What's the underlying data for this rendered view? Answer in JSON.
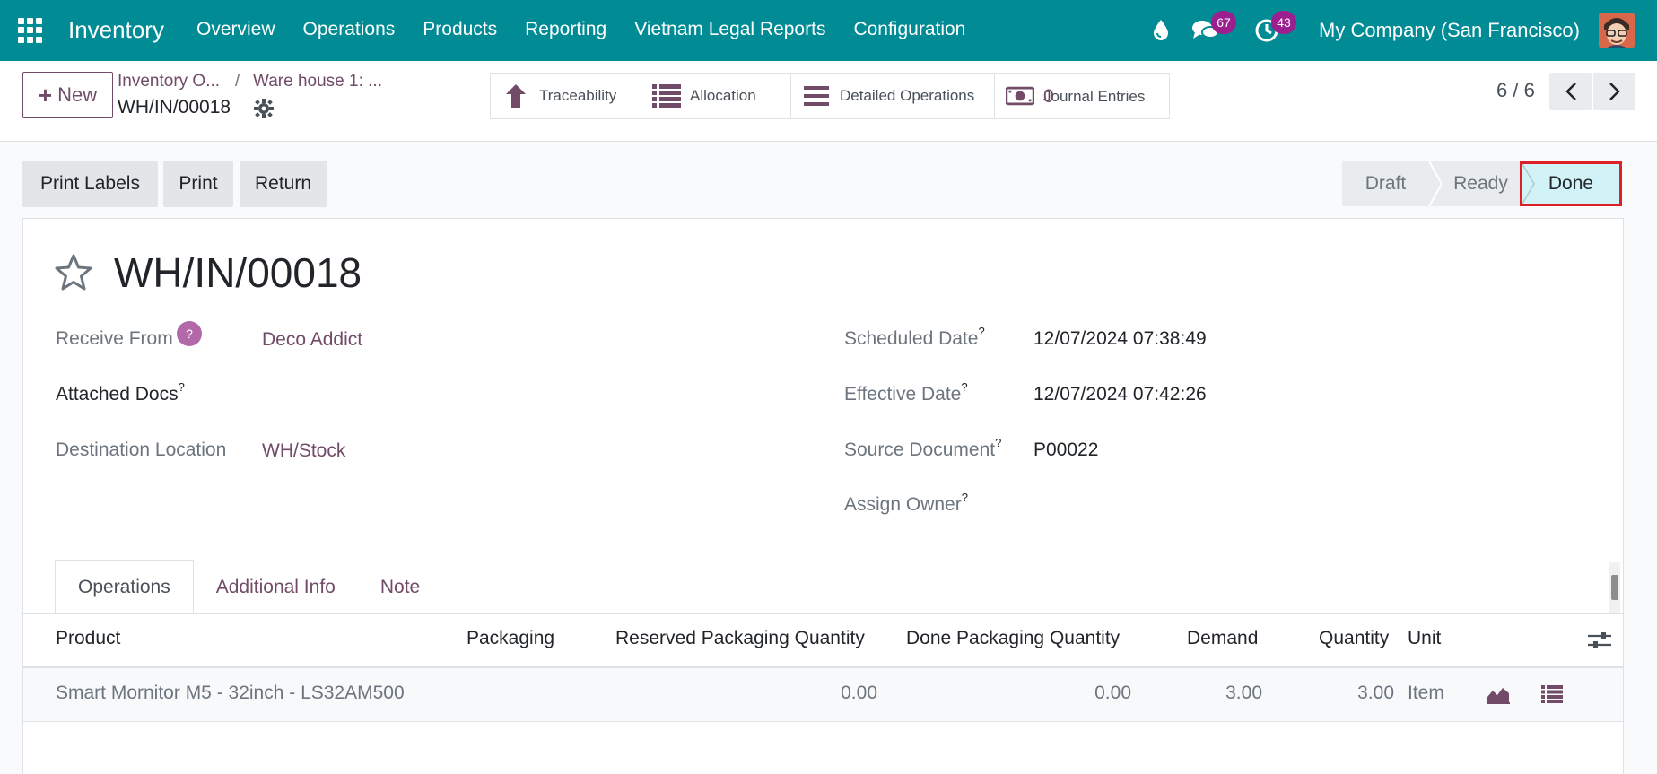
{
  "navbar": {
    "app_title": "Inventory",
    "menu": [
      "Overview",
      "Operations",
      "Products",
      "Reporting",
      "Vietnam Legal Reports",
      "Configuration"
    ],
    "messages_count": "67",
    "activities_count": "43",
    "company": "My Company (San Francisco)"
  },
  "control": {
    "new_label": "New",
    "breadcrumb": [
      "Inventory O...",
      "Ware house 1: ..."
    ],
    "breadcrumb_sep": "/",
    "record_name": "WH/IN/00018",
    "smart_buttons": {
      "traceability": "Traceability",
      "allocation": "Allocation",
      "detailed_operations": "Detailed Operations",
      "journal_entries": "Journal Entries",
      "journal_entries_count": "0"
    },
    "pager": "6 / 6"
  },
  "actions": {
    "print_labels": "Print Labels",
    "print": "Print",
    "return": "Return"
  },
  "statusbar": {
    "stages": [
      "Draft",
      "Ready",
      "Done"
    ],
    "current": "Done"
  },
  "record": {
    "title": "WH/IN/00018",
    "help_mark": "?",
    "fields_left": {
      "receive_from_label": "Receive From",
      "receive_from_value": "Deco Addict",
      "attached_docs_label": "Attached Docs",
      "destination_label": "Destination Location",
      "destination_value": "WH/Stock"
    },
    "fields_right": {
      "scheduled_label": "Scheduled Date",
      "scheduled_value": "12/07/2024 07:38:49",
      "effective_label": "Effective Date",
      "effective_value": "12/07/2024 07:42:26",
      "source_label": "Source Document",
      "source_value": "P00022",
      "owner_label": "Assign Owner"
    },
    "tooltip_mark": "?"
  },
  "tabs": [
    "Operations",
    "Additional Info",
    "Note"
  ],
  "table": {
    "headers": [
      "Product",
      "Packaging",
      "Reserved Packaging Quantity",
      "Done Packaging Quantity",
      "Demand",
      "Quantity",
      "Unit"
    ],
    "rows": [
      {
        "product": "Smart Mornitor M5 - 32inch - LS32AM500",
        "packaging": "",
        "reserved_pkg_qty": "0.00",
        "done_pkg_qty": "0.00",
        "demand": "3.00",
        "quantity": "3.00",
        "unit": "Item"
      }
    ]
  },
  "colors": {
    "navbar": "#018b94",
    "accent": "#714b67",
    "badge": "#9b1f8f",
    "done_stage_bg": "#d1f3f7",
    "highlight_border": "#dd1f26"
  }
}
